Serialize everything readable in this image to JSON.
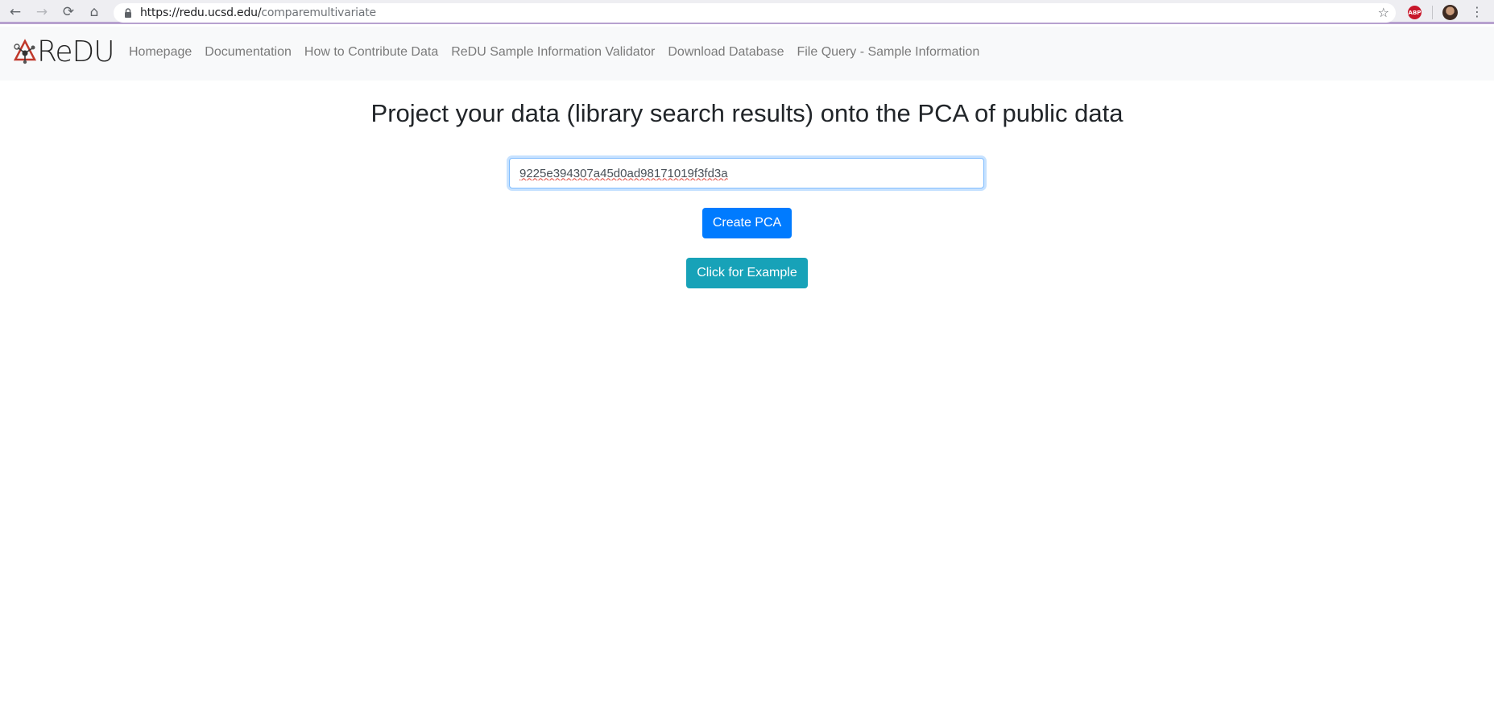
{
  "browser": {
    "url_host": "https://redu.ucsd.edu/",
    "url_path": "comparemultivariate",
    "extension_badge": "ABP"
  },
  "navbar": {
    "brand": "ReDU",
    "links": [
      "Homepage",
      "Documentation",
      "How to Contribute Data",
      "ReDU Sample Information Validator",
      "Download Database",
      "File Query - Sample Information"
    ]
  },
  "main": {
    "title": "Project your data (library search results) onto the PCA of public data",
    "task_input_value": "9225e394307a45d0ad98171019f3fd3a",
    "create_button": "Create PCA",
    "example_button": "Click for Example"
  },
  "icons": {
    "back": "back-arrow-icon",
    "forward": "forward-arrow-icon",
    "reload": "reload-icon",
    "home": "home-icon",
    "lock": "lock-icon",
    "star": "star-icon",
    "menu": "kebab-menu-icon",
    "logo": "redu-molecule-logo-icon"
  },
  "colors": {
    "primary": "#007bff",
    "info": "#17a2b8",
    "navbar_bg": "#f8f9fa",
    "browser_accent": "#b7a1cf"
  }
}
